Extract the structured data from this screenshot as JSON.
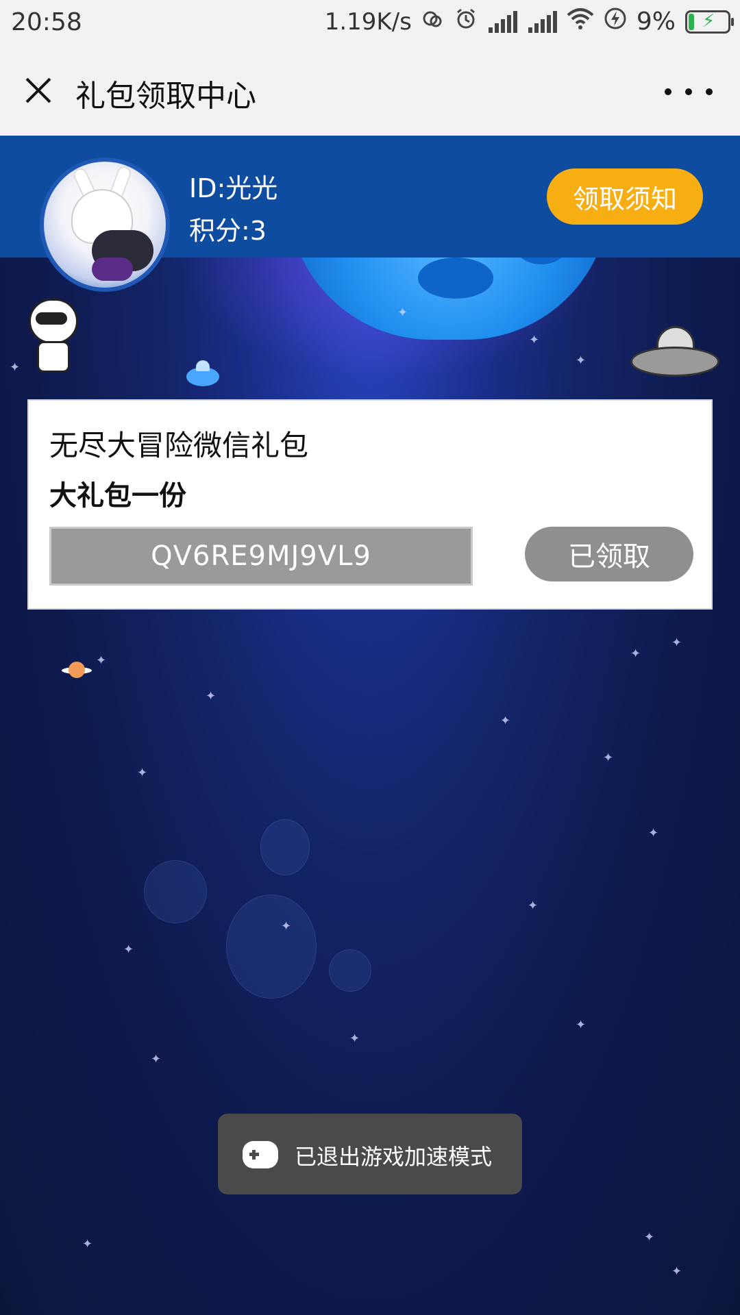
{
  "status_bar": {
    "time": "20:58",
    "network_speed": "1.19K/s",
    "battery_percent": "9%"
  },
  "title_bar": {
    "title": "礼包领取中心"
  },
  "user": {
    "id_text": "ID:光光",
    "points_text": "积分:3",
    "notice_button": "领取须知"
  },
  "gift": {
    "title": "无尽大冒险微信礼包",
    "description": "大礼包一份",
    "code": "QV6RE9MJ9VL9",
    "claimed_button": "已领取"
  },
  "toast": {
    "message": "已退出游戏加速模式"
  },
  "colors": {
    "header_blue": "#0e4c9f",
    "notice_orange": "#f7ae13",
    "claimed_gray": "#8f8f8f"
  }
}
